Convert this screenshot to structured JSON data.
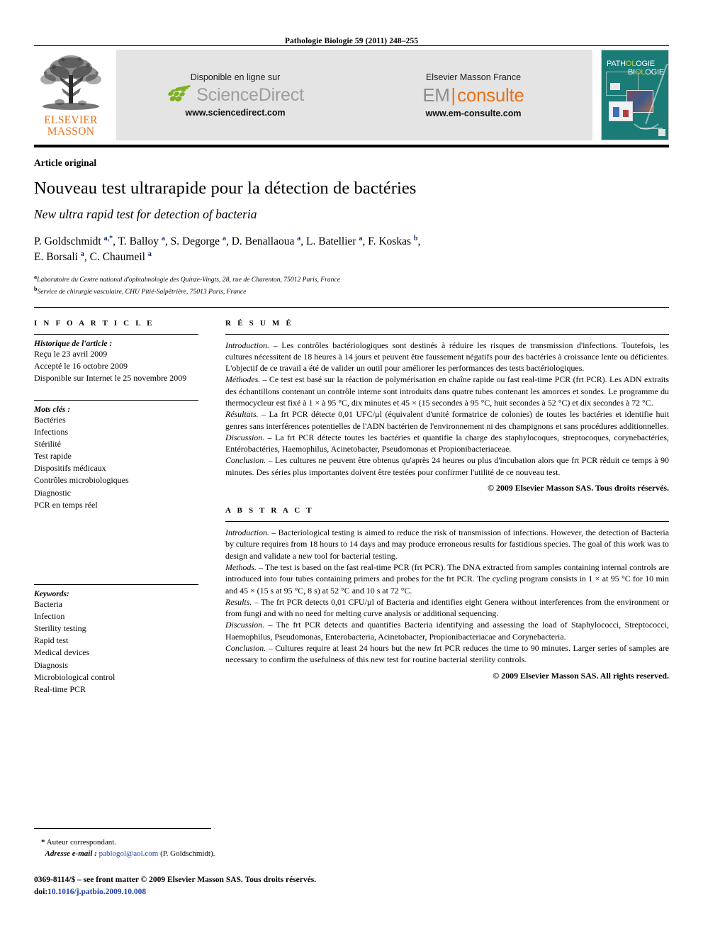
{
  "running_head": "Pathologie Biologie 59 (2011) 248–255",
  "banner": {
    "publisher_logo": {
      "line1": "ELSEVIER",
      "line2": "MASSON",
      "icon": "elsevier-tree-logo"
    },
    "sciencedirect": {
      "caption": "Disponible en ligne sur",
      "wordmark": "ScienceDirect",
      "url": "www.sciencedirect.com"
    },
    "emconsulte": {
      "caption": "Elsevier Masson France",
      "wordmark_left": "EM",
      "wordmark_right": "consulte",
      "url": "www.em-consulte.com"
    },
    "cover": {
      "line1": "PATHOLOGIE",
      "line2": "BIOLOGIE"
    }
  },
  "article": {
    "type": "Article original",
    "title_fr": "Nouveau test ultrarapide pour la détection de bactéries",
    "title_en": "New ultra rapid test for detection of bacteria",
    "authors_line1": "P. Goldschmidt a,*, T. Balloy a, S. Degorge a, D. Benallaoua a, L. Batellier a, F. Koskas b,",
    "authors_line2": "E. Borsali a, C. Chaumeil a",
    "affiliation_a": "Laboratoire du Centre national d'ophtalmologie des Quinze-Vingts, 28, rue de Charenton, 75012 Paris, France",
    "affiliation_b": "Service de chirurgie vasculaire, CHU Pitié-Salpêtrière, 75013 Paris, France"
  },
  "info": {
    "heading": "I N F O   A R T I C L E",
    "history_label": "Historique de l'article :",
    "history": [
      "Reçu le 23 avril 2009",
      "Accepté le 16 octobre 2009",
      "Disponible sur Internet le 25 novembre 2009"
    ],
    "keywords_fr_label": "Mots clés :",
    "keywords_fr": [
      "Bactéries",
      "Infections",
      "Stérilité",
      "Test rapide",
      "Dispositifs médicaux",
      "Contrôles microbiologiques",
      "Diagnostic",
      "PCR en temps réel"
    ],
    "keywords_en_label": "Keywords:",
    "keywords_en": [
      "Bacteria",
      "Infection",
      "Sterility testing",
      "Rapid test",
      "Medical devices",
      "Diagnosis",
      "Microbiological control",
      "Real-time PCR"
    ]
  },
  "resume": {
    "heading": "R É S U M É",
    "introduction_label": "Introduction. –",
    "introduction_text": " Les contrôles bactériologiques sont destinés à réduire les risques de transmission d'infections. Toutefois, les cultures nécessitent de 18 heures à 14 jours et peuvent être faussement négatifs pour des bactéries à croissance lente ou déficientes. L'objectif de ce travail a été de valider un outil pour améliorer les performances des tests bactériologiques.",
    "methodes_label": "Méthodes. –",
    "methodes_text": " Ce test est basé sur la réaction de polymérisation en chaîne rapide ou fast real-time PCR (frt PCR). Les ADN extraits des échantillons contenant un contrôle interne sont introduits dans quatre tubes contenant les amorces et sondes. Le programme du thermocycleur est fixé à 1 × à 95 °C, dix minutes et 45 × (15 secondes à 95 °C, huit secondes à 52 °C) et dix secondes à 72 °C.",
    "resultats_label": "Résultats. –",
    "resultats_text": " La frt PCR détecte 0,01 UFC/µl (équivalent d'unité formatrice de colonies) de toutes les bactéries et identifie huit genres sans interférences potentielles de l'ADN bactérien de l'environnement ni des champignons et sans procédures additionnelles.",
    "discussion_label": "Discussion. –",
    "discussion_text": " La frt PCR détecte toutes les bactéries et quantifie la charge des staphylocoques, streptocoques, corynebactéries, Entérobactéries, Haemophilus, Acinetobacter, Pseudomonas et Propionibacteriaceae.",
    "conclusion_label": "Conclusion. –",
    "conclusion_text": " Les cultures ne peuvent être obtenus qu'après 24 heures ou plus d'incubation alors que frt PCR réduit ce temps à 90 minutes. Des séries plus importantes doivent être testées pour confirmer l'utilité de ce nouveau test.",
    "copyright": "© 2009 Elsevier Masson SAS. Tous droits réservés."
  },
  "abstract": {
    "heading": "A B S T R A C T",
    "introduction_label": "Introduction.  –",
    "introduction_text": " Bacteriological testing is aimed to reduce the risk of transmission of infections. However, the detection of Bacteria by culture requires from 18 hours to 14 days and may produce erroneous results for fastidious species. The goal of this work was to design and validate a new tool for bacterial testing.",
    "methods_label": "Methods. –",
    "methods_text": " The test is based on the fast real-time PCR (frt PCR). The DNA extracted from samples containing internal controls are introduced into four tubes containing primers and probes for the frt PCR. The cycling program consists in 1 × at 95 °C for 10 min and 45 × (15 s at 95 °C, 8 s) at 52 °C and 10 s at 72 °C.",
    "results_label": "Results. –",
    "results_text": " The frt PCR detects 0,01 CFU/µl of Bacteria and identifies eight Genera without interferences from the environment or from fungi and with no need for melting curve analysis or additional sequencing.",
    "discussion_label": "Discussion. –",
    "discussion_text": " The frt PCR detects and quantifies Bacteria identifying and assessing the load of Staphylococci, Streptococci, Haemophilus, Pseudomonas, Enterobacteria, Acinetobacter, Propionibacteriacae and Corynebacteria.",
    "conclusion_label": "Conclusion. –",
    "conclusion_text": " Cultures require at least 24 hours but the new frt PCR reduces the time to 90 minutes. Larger series of samples are necessary to confirm the usefulness of this new test for routine bacterial sterility controls.",
    "copyright": "© 2009 Elsevier Masson SAS. All rights reserved."
  },
  "footer": {
    "corresponding_marker": "*",
    "corresponding_text": "Auteur correspondant.",
    "email_label": "Adresse e-mail :",
    "email": "pablogol@aol.com",
    "email_suffix": "(P. Goldschmidt).",
    "front_matter": "0369-8114/$ – see front matter © 2009 Elsevier Masson SAS. Tous droits réservés.",
    "doi_label": "doi:",
    "doi": "10.1016/j.patbio.2009.10.008"
  }
}
